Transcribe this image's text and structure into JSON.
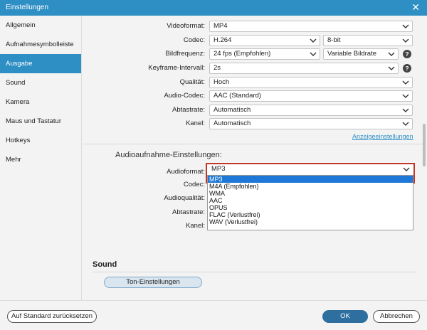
{
  "window": {
    "title": "Einstellungen"
  },
  "sidebar": {
    "items": [
      {
        "label": "Allgemein"
      },
      {
        "label": "Aufnahmesymbolleiste"
      },
      {
        "label": "Ausgabe"
      },
      {
        "label": "Sound"
      },
      {
        "label": "Kamera"
      },
      {
        "label": "Maus und Tastatur"
      },
      {
        "label": "Hotkeys"
      },
      {
        "label": "Mehr"
      }
    ],
    "active": "Ausgabe"
  },
  "video": {
    "format": {
      "label": "Videoformat:",
      "value": "MP4"
    },
    "codec": {
      "label": "Codec:",
      "value": "H.264",
      "depth": "8-bit"
    },
    "framerate": {
      "label": "Bildfrequenz:",
      "value": "24 fps (Empfohlen)",
      "bitrate": "Variable Bildrate"
    },
    "keyframe": {
      "label": "Keyframe-Intervall:",
      "value": "2s"
    },
    "quality": {
      "label": "Qualität:",
      "value": "Hoch"
    },
    "audio_codec": {
      "label": "Audio-Codec:",
      "value": "AAC (Standard)"
    },
    "samplerate": {
      "label": "Abtastrate:",
      "value": "Automatisch"
    },
    "channel": {
      "label": "Kanel:",
      "value": "Automatisch"
    },
    "display_settings_link": "Anzeigeeinstellungen"
  },
  "audio": {
    "section_title": "Audioaufnahme-Einstellungen:",
    "format": {
      "label": "Audioformat:",
      "value": "MP3"
    },
    "codec_label": "Codec:",
    "quality_label": "Audioqualität:",
    "samplerate_label": "Abtastrate:",
    "channel_label": "Kanel:",
    "dropdown_options": [
      "MP3",
      "M4A (Empfohlen)",
      "WMA",
      "AAC",
      "OPUS",
      "FLAC (Verlustfrei)",
      "WAV (Verlustfrei)"
    ],
    "dropdown_selected": "MP3"
  },
  "sound": {
    "heading": "Sound",
    "button": "Ton-Einstellungen"
  },
  "footer": {
    "reset": "Auf Standard zurücksetzen",
    "ok": "OK",
    "cancel": "Abbrechen"
  },
  "colors": {
    "accent": "#2e8fc4",
    "primary_button": "#2e6fa0",
    "highlight_border": "#c0392b",
    "selected_option": "#1e78d7"
  }
}
